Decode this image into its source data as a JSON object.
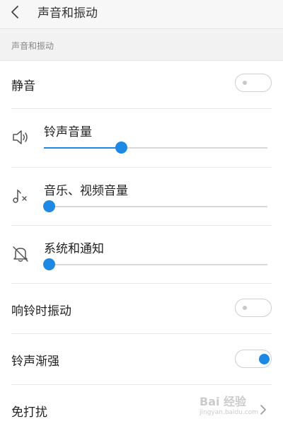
{
  "header": {
    "title": "声音和振动"
  },
  "section": {
    "title": "声音和振动"
  },
  "mute": {
    "label": "静音",
    "enabled": false
  },
  "ringtone_volume": {
    "label": "铃声音量",
    "level": 0.34
  },
  "media_volume": {
    "label": "音乐、视频音量",
    "level": 0.0
  },
  "system_volume": {
    "label": "系统和通知",
    "level": 0.0
  },
  "vibrate_on_ring": {
    "label": "响铃时振动",
    "enabled": false
  },
  "ringtone_crescendo": {
    "label": "铃声渐强",
    "enabled": true
  },
  "dnd": {
    "label": "免打扰"
  },
  "watermark": {
    "text": "Bai 经验",
    "url": "jingyan.baidu.com"
  },
  "colors": {
    "accent": "#1e88e5",
    "track": "#d9d9d9"
  }
}
